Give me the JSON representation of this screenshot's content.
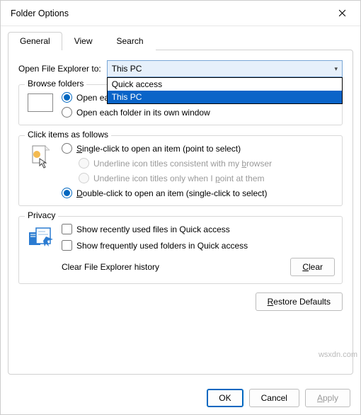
{
  "window": {
    "title": "Folder Options"
  },
  "tabs": {
    "general": "General",
    "view": "View",
    "search": "Search"
  },
  "open_to": {
    "label": "Open File Explorer to:",
    "selected": "This PC",
    "opt_quick": "Quick access",
    "opt_thispc": "This PC"
  },
  "browse": {
    "legend": "Browse folders",
    "same_window": "Open each folder in the same window",
    "own_window": "Open each folder in its own window"
  },
  "click": {
    "legend": "Click items as follows",
    "single": "Single-click to open an item (point to select)",
    "underline_browser": "Underline icon titles consistent with my browser",
    "underline_point": "Underline icon titles only when I point at them",
    "double": "Double-click to open an item (single-click to select)"
  },
  "privacy": {
    "legend": "Privacy",
    "recent_files": "Show recently used files in Quick access",
    "freq_folders": "Show frequently used folders in Quick access",
    "clear_label": "Clear File Explorer history",
    "clear_btn": "Clear"
  },
  "buttons": {
    "restore": "Restore Defaults",
    "ok": "OK",
    "cancel": "Cancel",
    "apply": "Apply"
  },
  "watermark": "wsxdn.com"
}
